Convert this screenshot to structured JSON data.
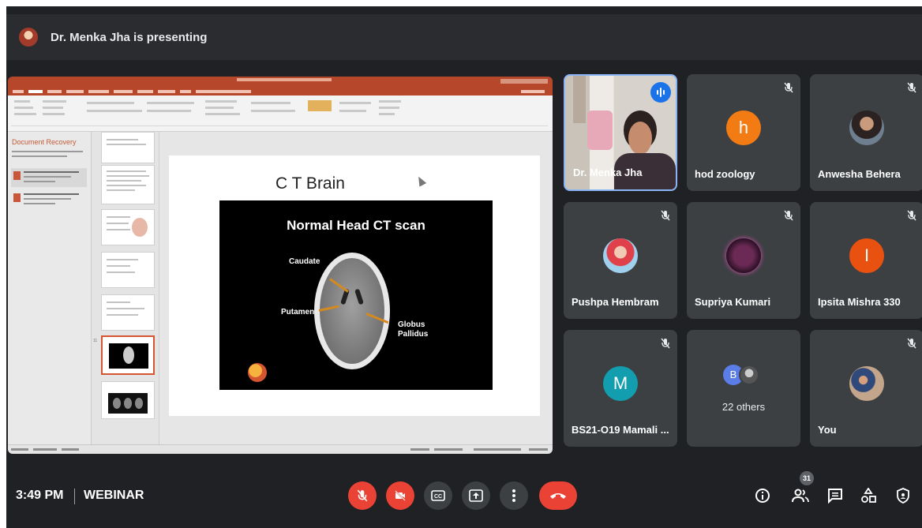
{
  "header": {
    "presenting_text": "Dr. Menka Jha is presenting"
  },
  "presentation": {
    "recovery_title": "Document Recovery",
    "slide_title": "C T Brain",
    "image": {
      "heading": "Normal Head CT scan",
      "labels": {
        "caudate": "Caudate",
        "putamen": "Putamen",
        "globus": "Globus\nPallidus"
      }
    }
  },
  "participants": [
    {
      "name": "Dr. Menka Jha",
      "type": "video",
      "speaking": true
    },
    {
      "name": "hod zoology",
      "initial": "h",
      "color": "#f27b13",
      "muted": true
    },
    {
      "name": "Anwesha Behera",
      "type": "photo",
      "muted": true
    },
    {
      "name": "Pushpa Hembram",
      "type": "photo",
      "muted": true
    },
    {
      "name": "Supriya Kumari",
      "type": "photo",
      "muted": true
    },
    {
      "name": "Ipsita Mishra 330",
      "initial": "I",
      "color": "#e8510f",
      "muted": true
    },
    {
      "name": "BS21-O19 Mamali ...",
      "initial": "M",
      "color": "#129eaf",
      "muted": true
    },
    {
      "name": "22 others",
      "initial": "B",
      "color": "#5b7de8"
    },
    {
      "name": "You",
      "type": "photo",
      "muted": true
    }
  ],
  "footer": {
    "time": "3:49 PM",
    "meeting_name": "WEBINAR",
    "people_count": "31"
  },
  "colors": {
    "end_call": "#ea4335",
    "muted": "#ea4335",
    "tile_bg": "#3c4043",
    "bar_bg": "#202124",
    "accent": "#1a73e8"
  }
}
